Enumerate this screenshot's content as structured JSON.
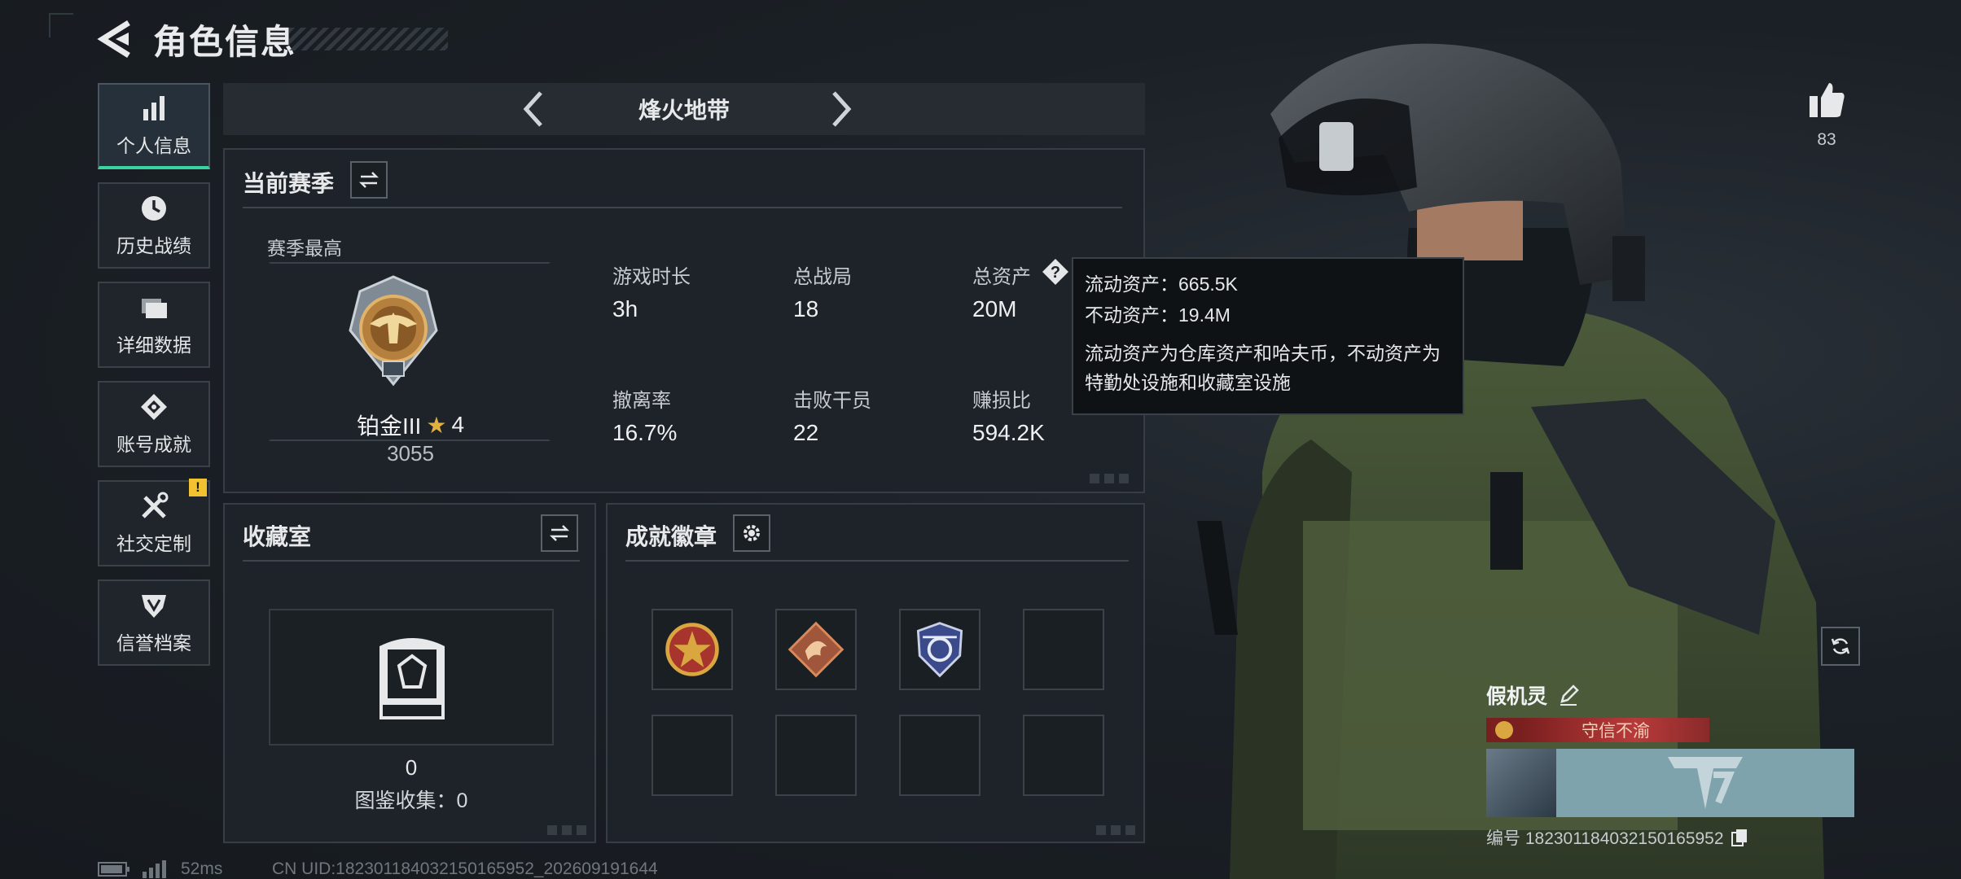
{
  "header": {
    "title": "角色信息",
    "back_icon": "back-arrow-icon"
  },
  "sidebar": {
    "items": [
      {
        "label": "个人信息",
        "icon": "bar-chart-icon",
        "active": true
      },
      {
        "label": "历史战绩",
        "icon": "clock-icon",
        "active": false
      },
      {
        "label": "详细数据",
        "icon": "folder-icon",
        "active": false
      },
      {
        "label": "账号成就",
        "icon": "achievement-icon",
        "active": false
      },
      {
        "label": "社交定制",
        "icon": "tools-icon",
        "active": false,
        "badge": "!"
      },
      {
        "label": "信誉档案",
        "icon": "shield-icon",
        "active": false
      }
    ]
  },
  "mode_selector": {
    "title": "烽火地带"
  },
  "season": {
    "title": "当前赛季",
    "best_label": "赛季最高",
    "rank_name": "铂金III",
    "rank_stars": "4",
    "rank_score": "3055",
    "stats": [
      {
        "label": "游戏时长",
        "value": "3h"
      },
      {
        "label": "总战局",
        "value": "18"
      },
      {
        "label": "总资产",
        "value": "20M"
      },
      {
        "label": "撤离率",
        "value": "16.7%"
      },
      {
        "label": "击败干员",
        "value": "22"
      },
      {
        "label": "赚损比",
        "value": "594.2K"
      }
    ]
  },
  "tooltip": {
    "liquid": "流动资产：665.5K",
    "fixed": "不动资产：19.4M",
    "desc": "流动资产为仓库资产和哈夫币，不动资产为特勤处设施和收藏室设施"
  },
  "collection": {
    "title": "收藏室",
    "count": "0",
    "codex": "图鉴收集：0"
  },
  "badges": {
    "title": "成就徽章"
  },
  "likes": {
    "count": "83"
  },
  "player": {
    "name": "假机灵",
    "title_tag": "守信不渝",
    "id_text": "编号 18230118403215016595​2"
  },
  "footer": {
    "ping": "52ms",
    "uid": "CN UID:182301184032150165952_202609191644"
  },
  "colors": {
    "accent": "#38d39f",
    "badge": "#f2c230",
    "tag": "#b83a3a"
  }
}
